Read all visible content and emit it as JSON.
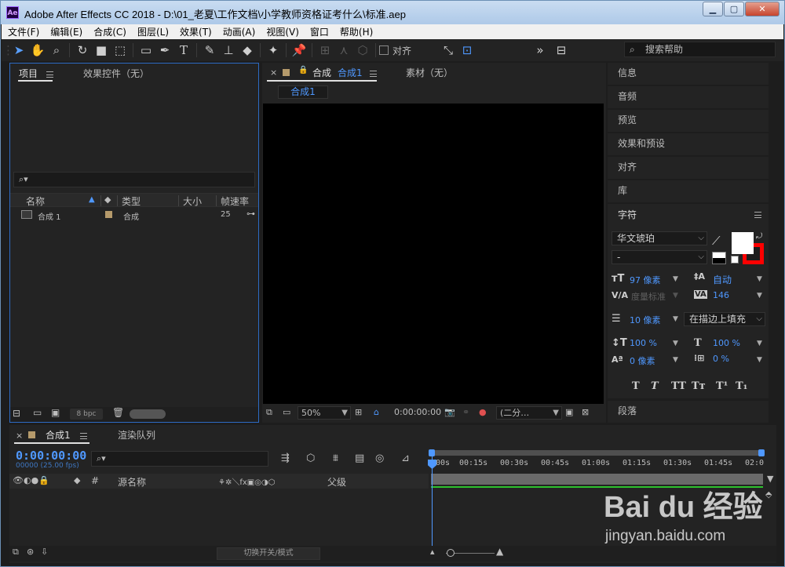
{
  "window": {
    "logo_text": "Ae",
    "title": "Adobe After Effects CC 2018 - D:\\01_老夏\\工作文档\\小学教师资格证考什么\\标准.aep",
    "min": "▁",
    "max": "▢",
    "close": "✕"
  },
  "menu": [
    "文件(F)",
    "编辑(E)",
    "合成(C)",
    "图层(L)",
    "效果(T)",
    "动画(A)",
    "视图(V)",
    "窗口",
    "帮助(H)"
  ],
  "toolbar": {
    "snap_label": "对齐",
    "overflow": "»",
    "search_placeholder": "搜索帮助",
    "search_icon": "⌕"
  },
  "project_panel": {
    "tab_project": "项目",
    "tab_effects": "效果控件（无）",
    "search_icon": "⌕▾",
    "columns": [
      "名称",
      "类型",
      "大小",
      "帧速率"
    ],
    "row": {
      "name": "合成 1",
      "type": "合成",
      "fps": "25"
    },
    "bpc": "8 bpc"
  },
  "comp_panel": {
    "close": "×",
    "tab_prefix": "合成",
    "tab_name": "合成1",
    "tab_footage": "素材（无）",
    "subtab": "合成1",
    "zoom": "50%",
    "timecode": "0:00:00:00",
    "resolution": "(二分…"
  },
  "right_dock": {
    "items": [
      "信息",
      "音频",
      "预览",
      "效果和预设",
      "对齐",
      "库"
    ],
    "char_title": "字符",
    "para_title": "段落"
  },
  "character": {
    "font": "华文琥珀",
    "style": "-",
    "size": "97 像素",
    "leading": "自动",
    "kerning": "度量标准",
    "tracking": "146",
    "stroke": "10 像素",
    "stroke_mode": "在描边上填充",
    "vscale": "100 %",
    "hscale": "100 %",
    "baseline": "0 像素",
    "tsume": "0 %",
    "format_buttons": [
      "T",
      "T",
      "TT",
      "Tт",
      "T¹",
      "T₁"
    ],
    "fill_color": "#ffffff",
    "stroke_color": "#ff0000"
  },
  "timeline": {
    "close": "×",
    "tab_comp": "合成1",
    "tab_render": "渲染队列",
    "time": "0:00:00:00",
    "fps": "00000 (25.00 fps)",
    "search_icon": "⌕▾",
    "hash": "#",
    "col_source": "源名称",
    "col_parent": "父级",
    "ruler": [
      "00s",
      "00:15s",
      "00:30s",
      "00:45s",
      "01:00s",
      "01:15s",
      "01:30s",
      "01:45s",
      "02:0"
    ],
    "switch_label": "切换开关/模式"
  },
  "watermark": {
    "logo": "Bai du 经验",
    "url": "jingyan.baidu.com"
  }
}
